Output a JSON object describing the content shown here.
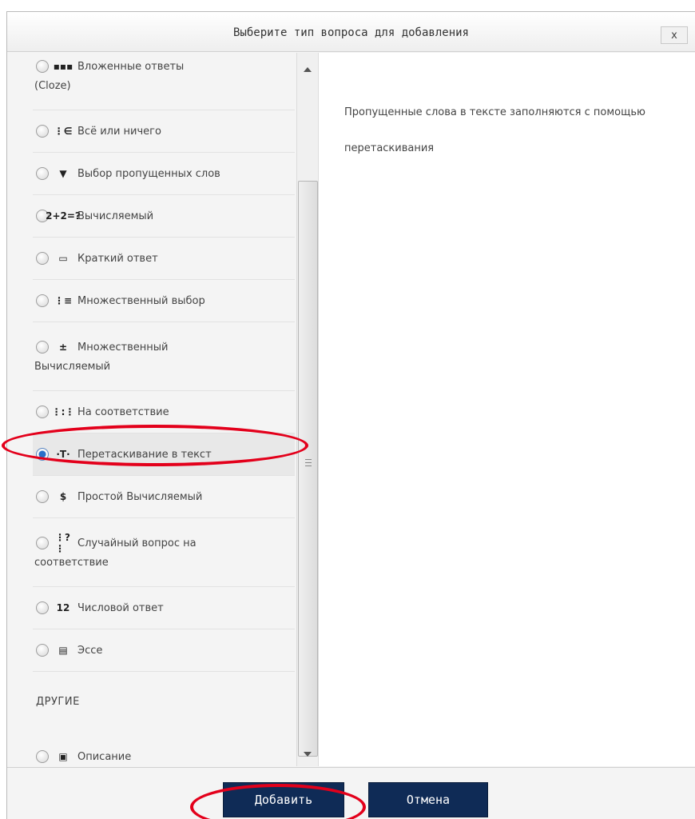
{
  "page": {
    "crumb": ""
  },
  "dialog": {
    "title": "Выберите тип вопроса для добавления",
    "close_label": "x"
  },
  "question_types": [
    {
      "label": "Вложенные ответы",
      "label2": "(Cloze)",
      "icon": "cloze-icon",
      "glyph": "▪▪▪",
      "checked": false
    },
    {
      "label": "Всё или ничего",
      "icon": "all-or-nothing-icon",
      "glyph": "⋮∈",
      "checked": false
    },
    {
      "label": "Выбор пропущенных слов",
      "icon": "dropdown-icon",
      "glyph": "▼",
      "checked": false
    },
    {
      "label": "Вычисляемый",
      "icon": "calculated-icon",
      "glyph": "2+2=?",
      "checked": false
    },
    {
      "label": "Краткий ответ",
      "icon": "short-answer-icon",
      "glyph": "▭",
      "checked": false
    },
    {
      "label": "Множественный выбор",
      "icon": "multichoice-icon",
      "glyph": "⋮≡",
      "checked": false
    },
    {
      "label": "Множественный",
      "label2": "Вычисляемый",
      "icon": "calculated-multi-icon",
      "glyph": "±",
      "checked": false
    },
    {
      "label": "На соответствие",
      "icon": "matching-icon",
      "glyph": "⋮:⋮",
      "checked": false
    },
    {
      "label": "Перетаскивание в текст",
      "icon": "drag-drop-text-icon",
      "glyph": "·T·",
      "checked": true
    },
    {
      "label": "Простой Вычисляемый",
      "icon": "simple-calculated-icon",
      "glyph": "$",
      "checked": false
    },
    {
      "label": "Случайный вопрос на",
      "label2": "соответствие",
      "icon": "random-matching-icon",
      "glyph": "⋮?⋮",
      "checked": false
    },
    {
      "label": "Числовой ответ",
      "icon": "numerical-icon",
      "glyph": "12",
      "checked": false
    },
    {
      "label": "Эссе",
      "icon": "essay-icon",
      "glyph": "▤",
      "checked": false
    }
  ],
  "other_section": {
    "heading": "ДРУГИЕ",
    "items": [
      {
        "label": "Описание",
        "icon": "description-icon",
        "glyph": "▣",
        "checked": false
      }
    ]
  },
  "description": "Пропущенные слова в тексте заполняются с помощью перетаскивания",
  "footer": {
    "add_label": "Добавить",
    "cancel_label": "Отмена"
  },
  "colors": {
    "button_bg": "#0f2b56",
    "highlight": "#e3001b"
  }
}
